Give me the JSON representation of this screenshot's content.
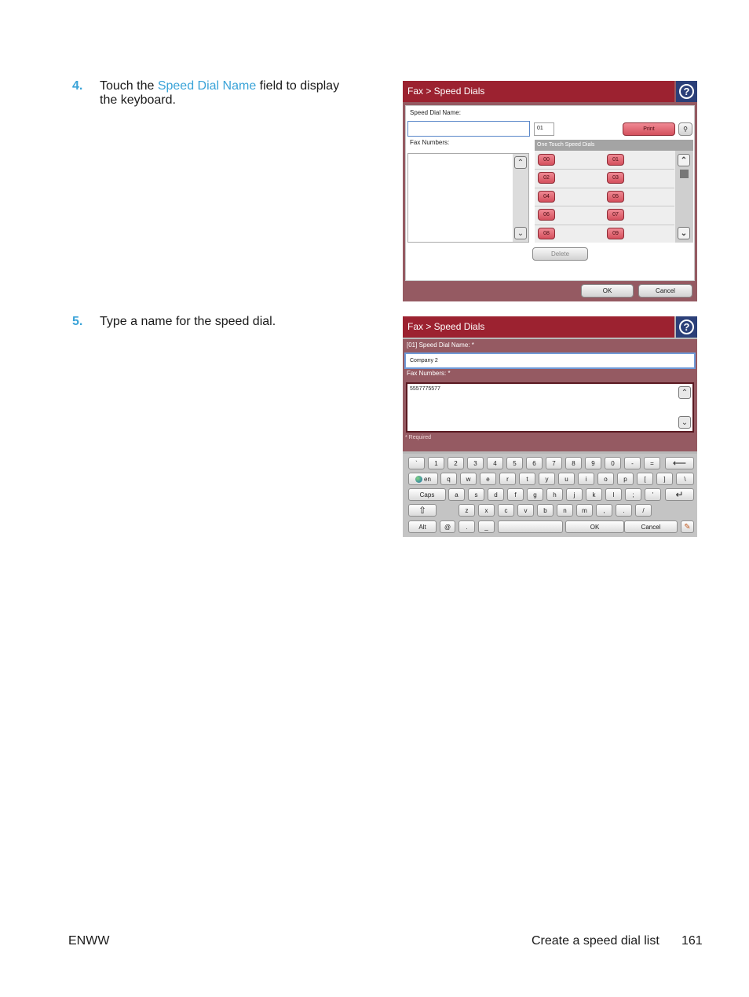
{
  "steps": [
    {
      "num": "4.",
      "text_before": "Touch the ",
      "link": "Speed Dial Name",
      "text_after": " field to display the keyboard."
    },
    {
      "num": "5.",
      "text": "Type a name for the speed dial."
    }
  ],
  "screen1": {
    "title": "Fax > Speed Dials",
    "speed_dial_name_label": "Speed Dial Name:",
    "speed_dial_name_value": "",
    "number_field": "01",
    "print_button": "Print",
    "fax_numbers_label": "Fax Numbers:",
    "list_header": "One Touch Speed Dials",
    "dials": [
      "00",
      "01",
      "02",
      "03",
      "04",
      "05",
      "06",
      "07",
      "08",
      "09"
    ],
    "delete_button": "Delete",
    "ok_button": "OK",
    "cancel_button": "Cancel"
  },
  "screen2": {
    "title": "Fax > Speed Dials",
    "name_label": "[01] Speed Dial Name: *",
    "name_value": "Company 2",
    "fax_label": "Fax Numbers: *",
    "fax_value": "5557775577",
    "required_note": "* Required",
    "keyboard": {
      "row1": [
        "`",
        "1",
        "2",
        "3",
        "4",
        "5",
        "6",
        "7",
        "8",
        "9",
        "0",
        "-",
        "="
      ],
      "row2": [
        "q",
        "w",
        "e",
        "r",
        "t",
        "y",
        "u",
        "i",
        "o",
        "p",
        "[",
        "]",
        "\\"
      ],
      "row3": [
        "a",
        "s",
        "d",
        "f",
        "g",
        "h",
        "j",
        "k",
        "l",
        ";",
        "'"
      ],
      "row4": [
        "z",
        "x",
        "c",
        "v",
        "b",
        "n",
        "m",
        ",",
        ".",
        "/"
      ],
      "lang": "en",
      "caps": "Caps",
      "alt": "Alt",
      "at": "@",
      "dot": ".",
      "underscore": "_",
      "ok": "OK",
      "cancel": "Cancel"
    }
  },
  "footer": {
    "left": "ENWW",
    "title": "Create a speed dial list",
    "page": "161"
  }
}
